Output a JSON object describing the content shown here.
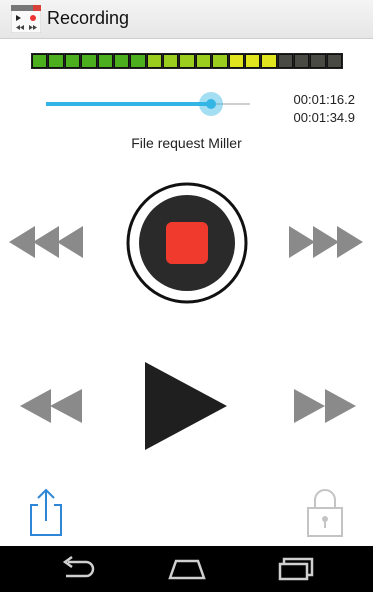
{
  "app": {
    "title": "Recording",
    "icon": "recorder-app-icon"
  },
  "level_meter": {
    "segments": 19,
    "lit_segments": 15,
    "colors": {
      "low": "#4caf1e",
      "mid": "#9acd1e",
      "high": "#e0e51e",
      "off": "#4a4a44"
    }
  },
  "playback": {
    "position_fraction": 0.81,
    "current_time": "00:01:16.2",
    "total_time": "00:01:34.9",
    "file_name": "File request Miller",
    "accent_color": "#33b5e5"
  },
  "controls": {
    "record_stop": "stop-record-button",
    "fast_rewind": "fast-rewind-button",
    "fast_forward": "fast-forward-button",
    "rewind": "rewind-button",
    "play": "play-button",
    "forward": "forward-button",
    "stop_color": "#f03a2e"
  },
  "bottom_actions": {
    "share": "share-icon",
    "lock": "lock-icon"
  },
  "system_nav": {
    "back": "back-icon",
    "home": "home-icon",
    "recents": "recents-icon"
  }
}
